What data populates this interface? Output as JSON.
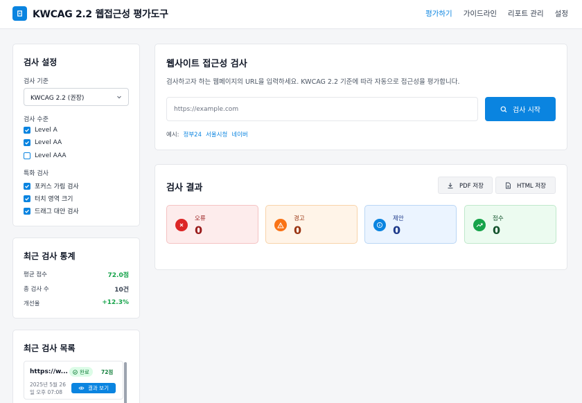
{
  "header": {
    "title": "KWCAG 2.2 웹접근성 평가도구",
    "nav": [
      "평가하기",
      "가이드라인",
      "리포트 관리",
      "설정"
    ]
  },
  "settings": {
    "title": "검사 설정",
    "standard_label": "검사 기준",
    "standard_value": "KWCAG 2.2 (권장)",
    "level_label": "검사 수준",
    "levels": [
      {
        "label": "Level A",
        "checked": true
      },
      {
        "label": "Level AA",
        "checked": true
      },
      {
        "label": "Level AAA",
        "checked": false
      }
    ],
    "special_label": "특화 검사",
    "specials": [
      {
        "label": "포커스 가림 검사",
        "checked": true
      },
      {
        "label": "터치 영역 크기",
        "checked": true
      },
      {
        "label": "드래그 대안 검사",
        "checked": true
      }
    ]
  },
  "stats": {
    "title": "최근 검사 통계",
    "rows": [
      {
        "label": "평균 점수",
        "value": "72.0점"
      },
      {
        "label": "총 검사 수",
        "value": "10건"
      },
      {
        "label": "개선율",
        "value": "+12.3%"
      }
    ]
  },
  "history": {
    "title": "최근 검사 목록",
    "items": [
      {
        "url": "https://w...",
        "status": "완료",
        "score": "72점",
        "date_line1": "2025년 5월 26",
        "date_line2": "일 오후 07:08",
        "view_label": "결과 보기"
      }
    ]
  },
  "check": {
    "title": "웹사이트 접근성 검사",
    "description": "검사하고자 하는 웹페이지의 URL을 입력하세요. KWCAG 2.2 기준에 따라 자동으로 접근성을 평가합니다.",
    "url_placeholder": "https://example.com",
    "start_label": "검사 시작",
    "examples_label": "예시:",
    "examples": [
      "정부24",
      "서울시청",
      "네이버"
    ]
  },
  "results": {
    "title": "검사 결과",
    "pdf_label": "PDF 저장",
    "html_label": "HTML 저장",
    "metrics": [
      {
        "label": "오류",
        "value": "0",
        "icon": "x-circle-icon",
        "bg": "#fdecec",
        "border": "#f5c2c2",
        "icon_bg": "#dc2626",
        "text": "#991b1b"
      },
      {
        "label": "경고",
        "value": "0",
        "icon": "warning-icon",
        "bg": "#fff4e8",
        "border": "#f8d3a9",
        "icon_bg": "#f97316",
        "text": "#9a3412"
      },
      {
        "label": "제안",
        "value": "0",
        "icon": "info-icon",
        "bg": "#ebf4ff",
        "border": "#b9d6f5",
        "icon_bg": "#0a84e0",
        "text": "#1e3a8a"
      },
      {
        "label": "점수",
        "value": "0",
        "icon": "trend-up-icon",
        "bg": "#ecfbf0",
        "border": "#bfe8cb",
        "icon_bg": "#16a34a",
        "text": "#14532d"
      }
    ]
  },
  "colors": {
    "accent": "#0a84e0",
    "positive": "#16a34a"
  }
}
